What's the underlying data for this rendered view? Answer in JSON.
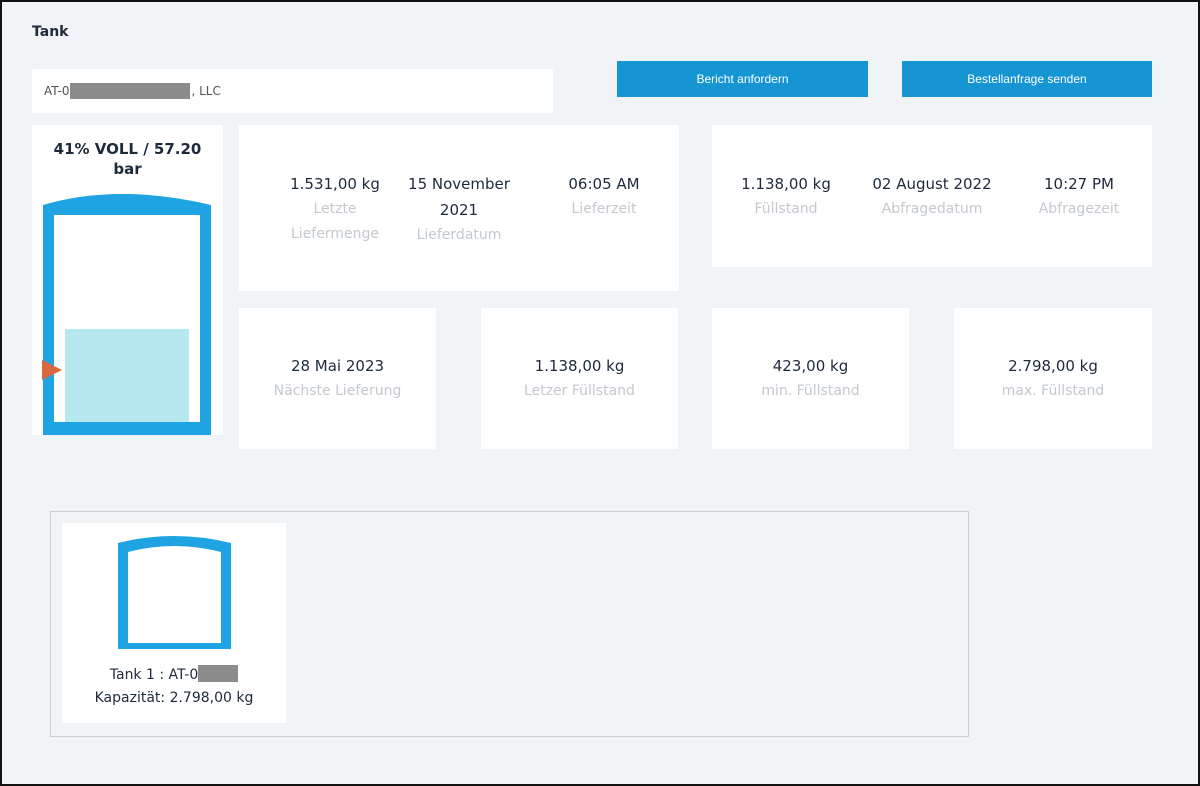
{
  "page": {
    "title": "Tank"
  },
  "selector": {
    "prefix": "AT-0",
    "suffix": ", LLC"
  },
  "actions": {
    "report_label": "Bericht anfordern",
    "order_label": "Bestellanfrage senden"
  },
  "gauge": {
    "label_line1": "41% VOLL / 57.20",
    "label_line2": "bar",
    "fill_fraction": 0.41,
    "colors": {
      "outline": "#1fa3e3",
      "fill": "#b5e8ef",
      "marker": "#d8693f"
    }
  },
  "delivery": {
    "amount": "1.531,00 kg",
    "amount_label_1": "Letzte",
    "amount_label_2": "Liefermenge",
    "date_1": "15 November",
    "date_2": "2021",
    "date_label": "Lieferdatum",
    "time": "06:05 AM",
    "time_label": "Lieferzeit"
  },
  "query": {
    "level": "1.138,00 kg",
    "level_label": "Füllstand",
    "date": "02 August 2022",
    "date_label": "Abfragedatum",
    "time": "10:27 PM",
    "time_label": "Abfragezeit"
  },
  "tiles": [
    {
      "value": "28 Mai 2023",
      "label": "Nächste Lieferung"
    },
    {
      "value": "1.138,00 kg",
      "label": "Letzer Füllstand"
    },
    {
      "value": "423,00 kg",
      "label": "min. Füllstand"
    },
    {
      "value": "2.798,00 kg",
      "label": "max. Füllstand"
    }
  ],
  "tank_list": [
    {
      "name_prefix": "Tank 1 : AT-0",
      "capacity": "Kapazität: 2.798,00 kg"
    }
  ]
}
